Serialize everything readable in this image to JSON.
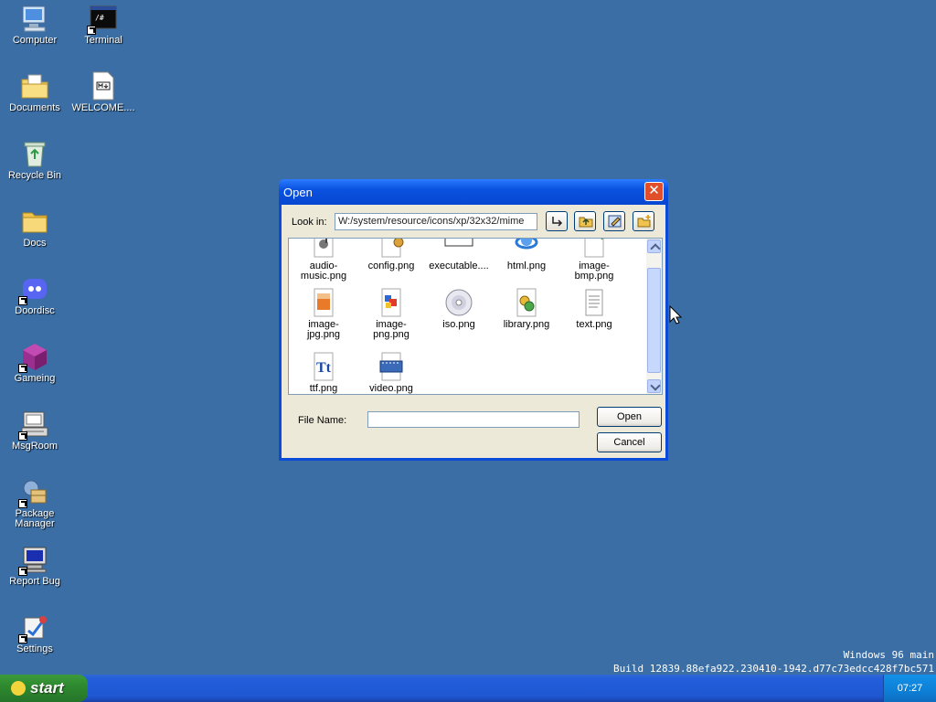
{
  "desktop": {
    "icons": [
      {
        "label": "Computer"
      },
      {
        "label": "Terminal"
      },
      {
        "label": "Documents"
      },
      {
        "label": "WELCOME...."
      },
      {
        "label": "Recycle Bin"
      },
      {
        "label": "Docs"
      },
      {
        "label": "Doordisc"
      },
      {
        "label": "Gameing"
      },
      {
        "label": "MsgRoom"
      },
      {
        "label": "Package Manager"
      },
      {
        "label": "Report Bug"
      },
      {
        "label": "Settings"
      }
    ]
  },
  "dialog": {
    "title": "Open",
    "close_glyph": "✕",
    "look_in_label": "Look in:",
    "path": "W:/system/resource/icons/xp/32x32/mime",
    "toolbar_icons": [
      "go-to-path-icon",
      "up-folder-icon",
      "edit-icon",
      "new-folder-icon"
    ],
    "files": [
      {
        "name": "audio-music.png",
        "icon": "audio-file-icon"
      },
      {
        "name": "config.png",
        "icon": "config-file-icon"
      },
      {
        "name": "executable....",
        "icon": "executable-file-icon"
      },
      {
        "name": "html.png",
        "icon": "html-file-icon"
      },
      {
        "name": "image-bmp.png",
        "icon": "image-bmp-icon"
      },
      {
        "name": "image-jpg.png",
        "icon": "image-jpg-icon"
      },
      {
        "name": "image-png.png",
        "icon": "image-png-icon"
      },
      {
        "name": "iso.png",
        "icon": "disc-icon"
      },
      {
        "name": "library.png",
        "icon": "library-icon"
      },
      {
        "name": "text.png",
        "icon": "text-file-icon"
      },
      {
        "name": "ttf.png",
        "icon": "font-file-icon"
      },
      {
        "name": "video.png",
        "icon": "video-file-icon"
      }
    ],
    "file_name_label": "File Name:",
    "file_name_value": "",
    "open_label": "Open",
    "cancel_label": "Cancel"
  },
  "taskbar": {
    "start_label": "start",
    "clock": "07:27"
  },
  "build_info": {
    "line1": "Windows 96 main",
    "line2": "Build 12839.88efa922.230410-1942.d77c73edcc428f7bc571"
  },
  "colors": {
    "desktop": "#3a6ea5",
    "titlebar": "#0a52e0",
    "dialog_body": "#ece9d8",
    "taskbar": "#245edb",
    "start": "#2e8a2e"
  }
}
